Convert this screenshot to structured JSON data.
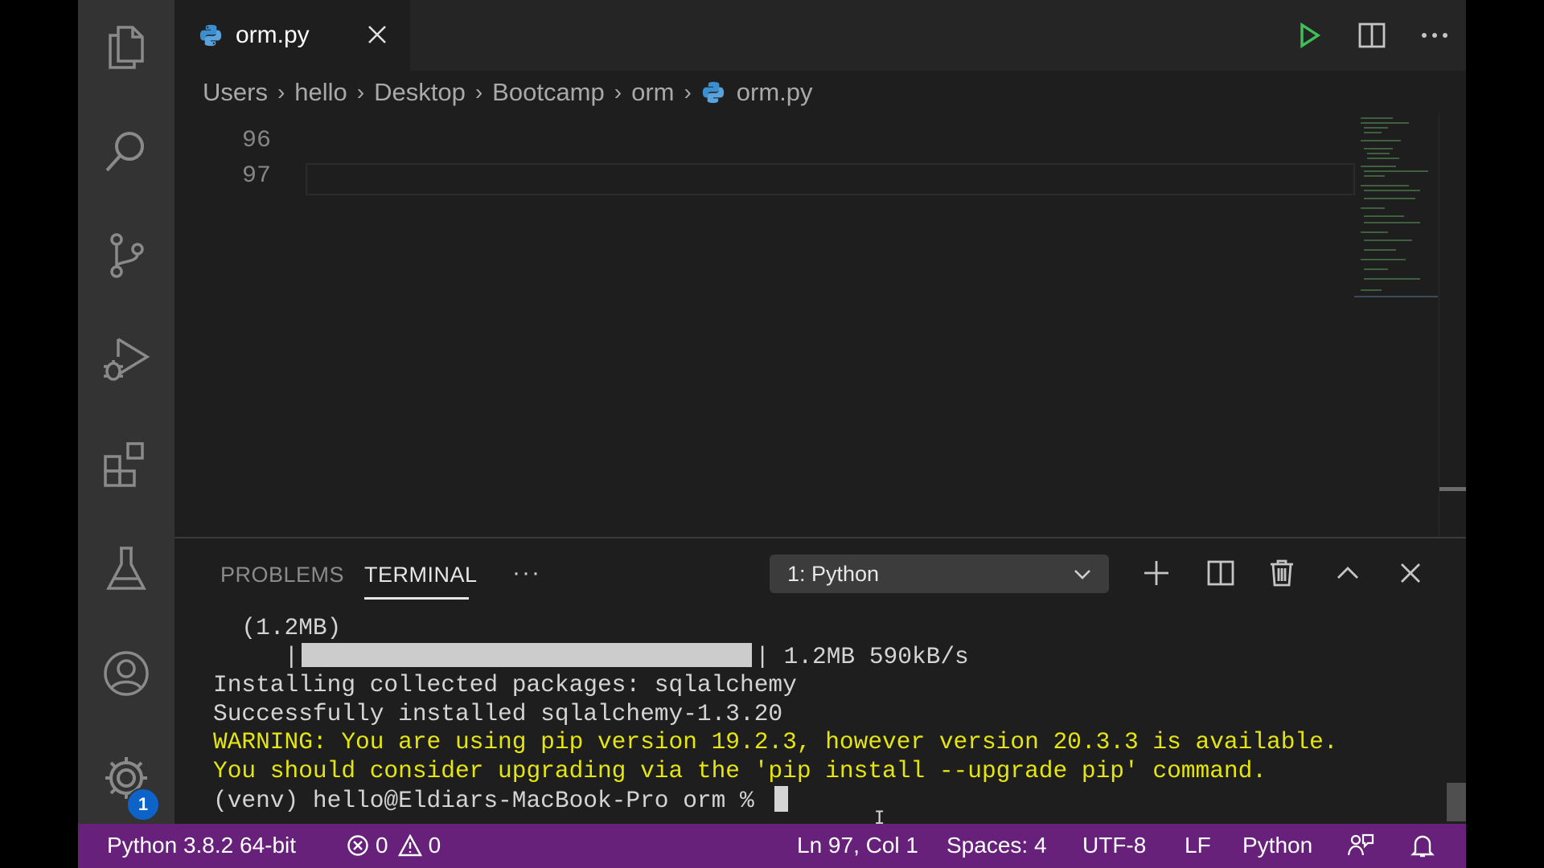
{
  "tab": {
    "label": "orm.py"
  },
  "breadcrumb": {
    "items": [
      "Users",
      "hello",
      "Desktop",
      "Bootcamp",
      "orm",
      "orm.py"
    ]
  },
  "editor": {
    "line_numbers": [
      "96",
      "97"
    ]
  },
  "panel": {
    "tabs": [
      "PROBLEMS",
      "TERMINAL"
    ],
    "more": "···",
    "terminal_select": "1: Python"
  },
  "terminal": {
    "line1": "(1.2MB)",
    "line2_suffix": "| 1.2MB 590kB/s",
    "line3": "Installing collected packages: sqlalchemy",
    "line4": "Successfully installed sqlalchemy-1.3.20",
    "line5": "WARNING: You are using pip version 19.2.3, however version 20.3.3 is available.",
    "line6": "You should consider upgrading via the 'pip install --upgrade pip' command.",
    "prompt": "(venv) hello@Eldiars-MacBook-Pro orm % "
  },
  "activity": {
    "settings_badge": "1"
  },
  "status": {
    "interpreter": "Python 3.8.2 64-bit",
    "errors": "0",
    "warnings": "0",
    "position": "Ln 97, Col 1",
    "spaces": "Spaces: 4",
    "encoding": "UTF-8",
    "eol": "LF",
    "language": "Python"
  },
  "colors": {
    "status_bar": "#68217a",
    "activity_bar": "#333333",
    "editor_bg": "#1e1e1e",
    "warning_text": "#e5e510",
    "run_button": "#3fc15a"
  }
}
